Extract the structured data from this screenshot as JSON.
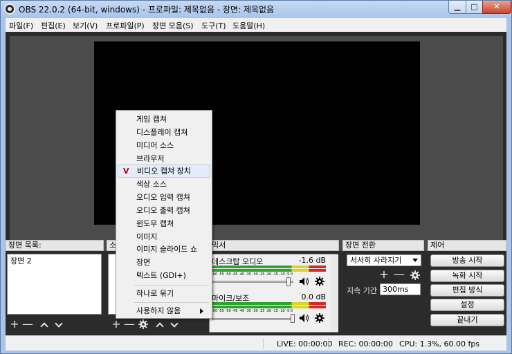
{
  "window": {
    "title": "OBS 22.0.2 (64-bit, windows) - 프로파일: 제목없음 - 장면: 제목없음",
    "minimize_glyph": "▁",
    "maximize_glyph": "□",
    "close_glyph": "✕"
  },
  "menubar": {
    "items": [
      {
        "label": "파일(F)"
      },
      {
        "label": "편집(E)"
      },
      {
        "label": "보기(V)"
      },
      {
        "label": "프로파일(P)"
      },
      {
        "label": "장면 모음(S)"
      },
      {
        "label": "도구(T)"
      },
      {
        "label": "도움말(H)"
      }
    ]
  },
  "docks": {
    "scenes": {
      "title": "장면 목록:",
      "items": [
        "장면 2"
      ]
    },
    "sources": {
      "title": "소"
    },
    "mixer": {
      "title": "믹서"
    },
    "transitions": {
      "title": "장면 전환",
      "selected": "서서히 사라지기",
      "duration_label": "지속 기간",
      "duration_value": "300ms"
    },
    "controls": {
      "title": "제어",
      "buttons": [
        "방송 시작",
        "녹화 시작",
        "편집 방식",
        "설정",
        "끝내기"
      ]
    }
  },
  "toolbar_glyphs": {
    "add": "+",
    "remove": "—"
  },
  "mixer": {
    "scale": "-60 -55 -50 -45 -40 -35 -30 -25 -20 -15 -10 -5 0",
    "tracks": [
      {
        "name": "데스크탑 오디오",
        "db": "-1.6 dB",
        "level": 0.92
      },
      {
        "name": "마이크/보조",
        "db": "0.0 dB",
        "level": 0.78
      }
    ]
  },
  "context_menu": {
    "items": [
      {
        "label": "게임 캡쳐"
      },
      {
        "label": "디스플레이 캡쳐"
      },
      {
        "label": "미디어 소스"
      },
      {
        "label": "브라우저"
      },
      {
        "label": "비디오 캡쳐 장치",
        "checked": true
      },
      {
        "label": "색상 소스"
      },
      {
        "label": "오디오 입력 캡쳐"
      },
      {
        "label": "오디오 출력 캡쳐"
      },
      {
        "label": "윈도우 캡쳐"
      },
      {
        "label": "이미지"
      },
      {
        "label": "이미지 슬라이드 쇼"
      },
      {
        "label": "장면"
      },
      {
        "label": "텍스트 (GDI+)"
      },
      {
        "label": "하나로 묶기"
      },
      {
        "label": "사용하지 않음"
      }
    ],
    "check_mark": "V"
  },
  "status": {
    "live": "LIVE: 00:00:00",
    "rec": "REC: 00:00:00",
    "cpu": "CPU: 1.3%, 60.00 fps"
  }
}
